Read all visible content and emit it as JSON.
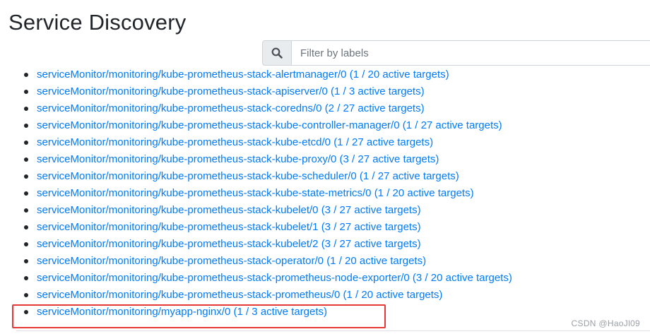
{
  "page": {
    "title": "Service Discovery"
  },
  "search": {
    "placeholder": "Filter by labels",
    "button_icon": "search-icon"
  },
  "targets": [
    {
      "name": "serviceMonitor/monitoring/kube-prometheus-stack-alertmanager/0",
      "status": "(1 / 20 active targets)"
    },
    {
      "name": "serviceMonitor/monitoring/kube-prometheus-stack-apiserver/0",
      "status": "(1 / 3 active targets)"
    },
    {
      "name": "serviceMonitor/monitoring/kube-prometheus-stack-coredns/0",
      "status": "(2 / 27 active targets)"
    },
    {
      "name": "serviceMonitor/monitoring/kube-prometheus-stack-kube-controller-manager/0",
      "status": "(1 / 27 active targets)"
    },
    {
      "name": "serviceMonitor/monitoring/kube-prometheus-stack-kube-etcd/0",
      "status": "(1 / 27 active targets)"
    },
    {
      "name": "serviceMonitor/monitoring/kube-prometheus-stack-kube-proxy/0",
      "status": "(3 / 27 active targets)"
    },
    {
      "name": "serviceMonitor/monitoring/kube-prometheus-stack-kube-scheduler/0",
      "status": "(1 / 27 active targets)"
    },
    {
      "name": "serviceMonitor/monitoring/kube-prometheus-stack-kube-state-metrics/0",
      "status": "(1 / 20 active targets)"
    },
    {
      "name": "serviceMonitor/monitoring/kube-prometheus-stack-kubelet/0",
      "status": "(3 / 27 active targets)"
    },
    {
      "name": "serviceMonitor/monitoring/kube-prometheus-stack-kubelet/1",
      "status": "(3 / 27 active targets)"
    },
    {
      "name": "serviceMonitor/monitoring/kube-prometheus-stack-kubelet/2",
      "status": "(3 / 27 active targets)"
    },
    {
      "name": "serviceMonitor/monitoring/kube-prometheus-stack-operator/0",
      "status": "(1 / 20 active targets)"
    },
    {
      "name": "serviceMonitor/monitoring/kube-prometheus-stack-prometheus-node-exporter/0",
      "status": "(3 / 20 active targets)"
    },
    {
      "name": "serviceMonitor/monitoring/kube-prometheus-stack-prometheus/0",
      "status": "(1 / 20 active targets)"
    },
    {
      "name": "serviceMonitor/monitoring/myapp-nginx/0",
      "status": "(1 / 3 active targets)"
    }
  ],
  "watermark": "CSDN @HaoJl09",
  "colors": {
    "link": "#007bff",
    "highlight": "#e53935",
    "title": "#212529"
  }
}
